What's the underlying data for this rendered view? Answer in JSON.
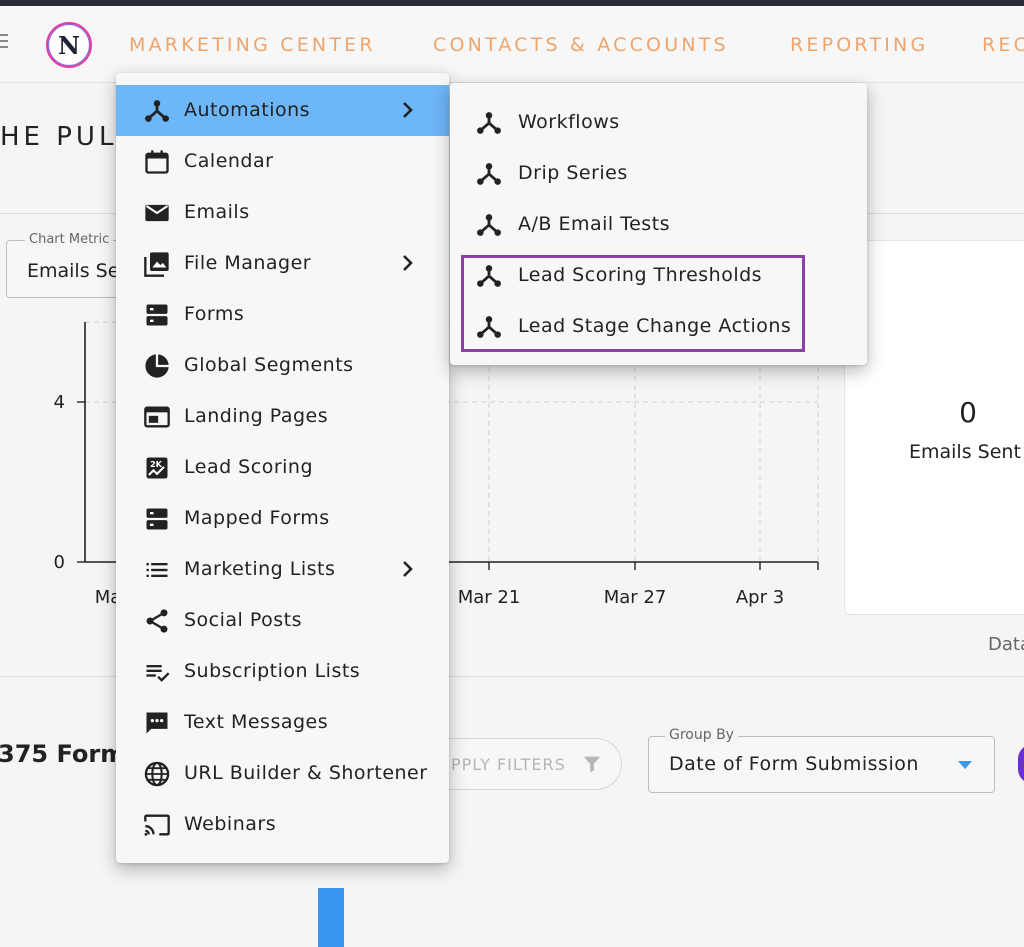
{
  "nav": {
    "logo_letter": "N",
    "links": [
      "MARKETING CENTER",
      "CONTACTS & ACCOUNTS",
      "REPORTING",
      "REC"
    ]
  },
  "page": {
    "title": "HE PULS"
  },
  "chart_panel": {
    "metric_label": "Chart Metric",
    "metric_value": "Emails Se"
  },
  "chart_data": {
    "type": "bar",
    "x_tick_labels": [
      "Ma",
      "Mar 21",
      "Mar 27",
      "Apr 3"
    ],
    "y_tick_labels": [
      "0",
      "4"
    ],
    "ylim": [
      0,
      6
    ],
    "grid": true
  },
  "stat_card": {
    "value": "0",
    "caption": "Emails Sent"
  },
  "data_text": "Data",
  "forms": {
    "title": "375 Form",
    "apply_filters": "PPLY FILTERS",
    "group_by_label": "Group By",
    "group_by_value": "Date of Form Submission"
  },
  "menu": {
    "items": [
      {
        "label": "Automations",
        "icon": "automation-icon",
        "submenu": true,
        "active": true
      },
      {
        "label": "Calendar",
        "icon": "calendar-icon",
        "submenu": false
      },
      {
        "label": "Emails",
        "icon": "email-icon",
        "submenu": false
      },
      {
        "label": "File Manager",
        "icon": "photo-library-icon",
        "submenu": true
      },
      {
        "label": "Forms",
        "icon": "forms-icon",
        "submenu": false
      },
      {
        "label": "Global Segments",
        "icon": "pie-chart-icon",
        "submenu": false
      },
      {
        "label": "Landing Pages",
        "icon": "web-page-icon",
        "submenu": false
      },
      {
        "label": "Lead Scoring",
        "icon": "score-icon",
        "submenu": false
      },
      {
        "label": "Mapped Forms",
        "icon": "forms-icon",
        "submenu": false
      },
      {
        "label": "Marketing Lists",
        "icon": "list-icon",
        "submenu": true
      },
      {
        "label": "Social Posts",
        "icon": "share-icon",
        "submenu": false
      },
      {
        "label": "Subscription Lists",
        "icon": "playlist-check-icon",
        "submenu": false
      },
      {
        "label": "Text Messages",
        "icon": "sms-icon",
        "submenu": false
      },
      {
        "label": "URL Builder & Shortener",
        "icon": "globe-icon",
        "submenu": false
      },
      {
        "label": "Webinars",
        "icon": "cast-icon",
        "submenu": false
      }
    ]
  },
  "submenu": {
    "items": [
      {
        "label": "Workflows",
        "icon": "automation-icon"
      },
      {
        "label": "Drip Series",
        "icon": "automation-icon"
      },
      {
        "label": "A/B Email Tests",
        "icon": "automation-icon"
      },
      {
        "label": "Lead Scoring Thresholds",
        "icon": "automation-icon"
      },
      {
        "label": "Lead Stage Change Actions",
        "icon": "automation-icon"
      }
    ]
  },
  "colors": {
    "nav_link": "#f0a46a",
    "menu_active": "#6db6f7",
    "highlight_border": "#8e3ea7",
    "accent_blue": "#3b96f0"
  }
}
